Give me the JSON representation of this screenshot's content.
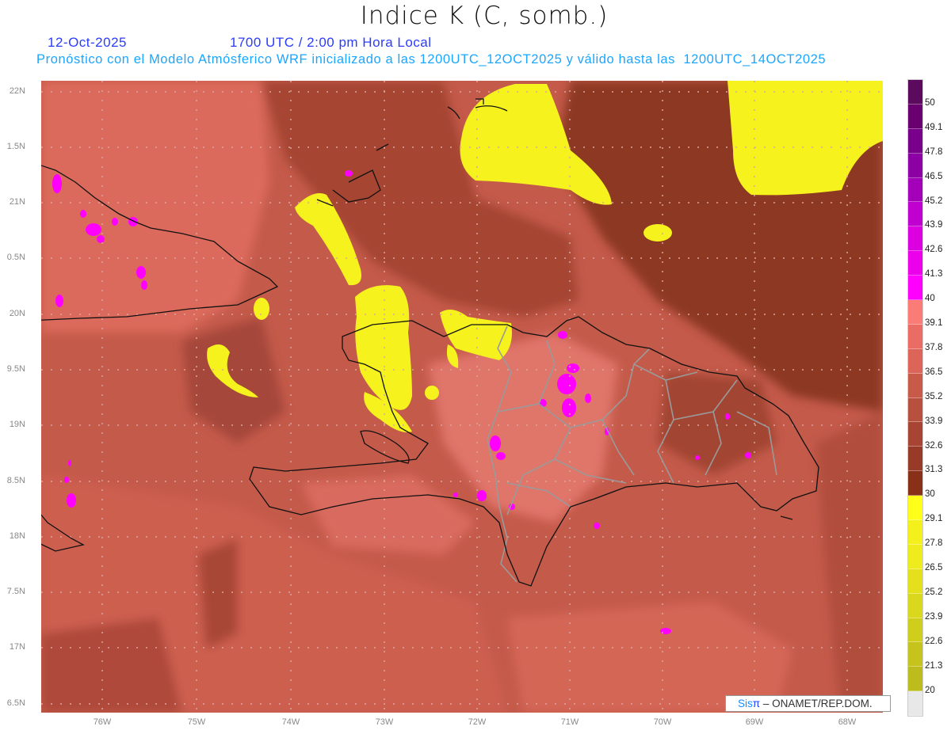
{
  "header": {
    "title": "Indice K (C, somb.)",
    "date": "12-Oct-2025",
    "time": "1700 UTC / 2:00 pm Hora Local",
    "description": "Pronóstico con el Modelo Atmósferico WRF inicializado a las 1200UTC_12OCT2025 y válido hasta las  1200UTC_14OCT2025"
  },
  "axes": {
    "lat_labels": [
      "22N",
      "1.5N",
      "21N",
      "0.5N",
      "20N",
      "9.5N",
      "19N",
      "8.5N",
      "18N",
      "7.5N",
      "17N",
      "6.5N"
    ],
    "lon_labels": [
      "76W",
      "75W",
      "74W",
      "73W",
      "72W",
      "71W",
      "70W",
      "69W",
      "68W"
    ]
  },
  "colorbar": {
    "labels": [
      "50",
      "49.1",
      "47.8",
      "46.5",
      "45.2",
      "43.9",
      "42.6",
      "41.3",
      "40",
      "39.1",
      "37.8",
      "36.5",
      "35.2",
      "33.9",
      "32.6",
      "31.3",
      "30",
      "29.1",
      "27.8",
      "26.5",
      "25.2",
      "23.9",
      "22.6",
      "21.3",
      "20"
    ],
    "colors": [
      "#5c0a5e",
      "#6a0070",
      "#78008a",
      "#8c00a4",
      "#a400ba",
      "#c000d0",
      "#dc00e0",
      "#ec00ec",
      "#ff00ff",
      "#fb7b77",
      "#ea6c64",
      "#dc6458",
      "#c85a4a",
      "#b85040",
      "#a84434",
      "#983a28",
      "#883018",
      "#ffff1a",
      "#f4f01c",
      "#eeec1c",
      "#e4e01c",
      "#dad81c",
      "#d0ce1c",
      "#c6c41c",
      "#bcbc1c",
      "#e8e8e8"
    ]
  },
  "credit": {
    "brand": "Sis",
    "brand_symbol": "π",
    "text": " –  ONAMET/REP.DOM."
  }
}
